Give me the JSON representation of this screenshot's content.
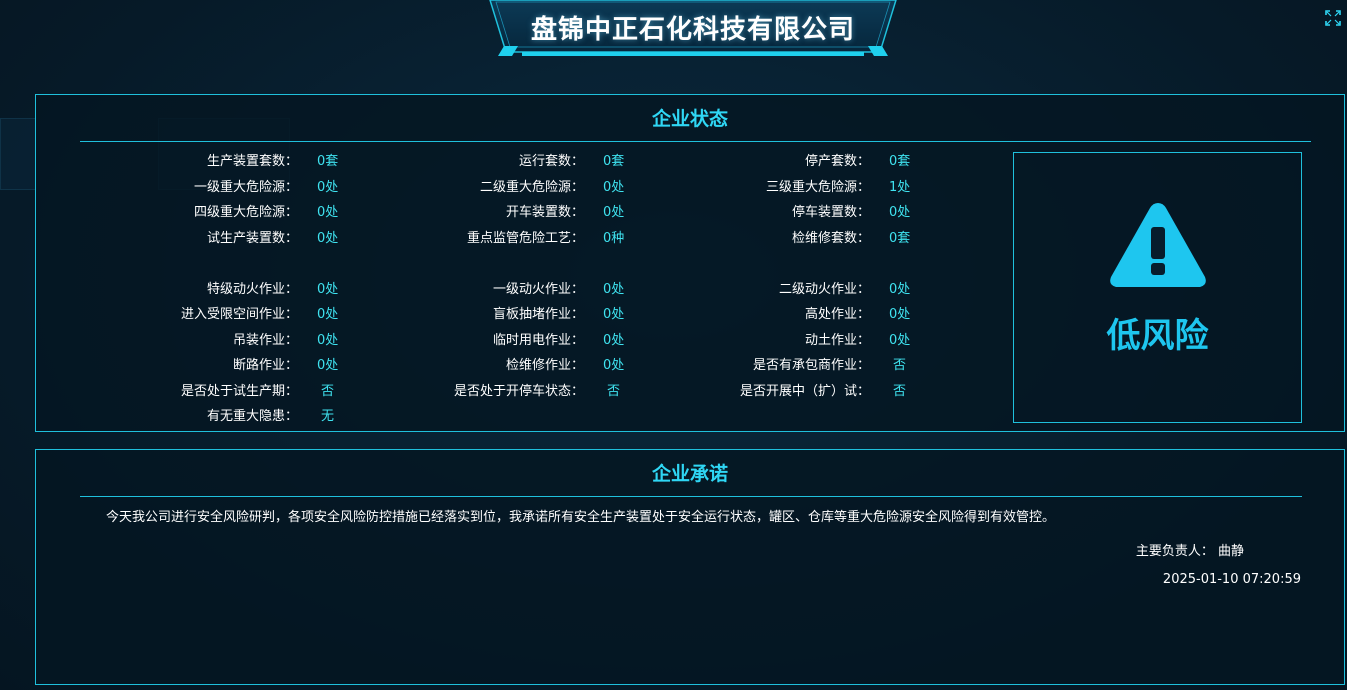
{
  "header": {
    "title": "盘锦中正石化科技有限公司"
  },
  "status_panel": {
    "title": "企业状态",
    "rows": [
      [
        {
          "label": "生产装置套数：",
          "value": "0套"
        },
        {
          "label": "运行套数：",
          "value": "0套"
        },
        {
          "label": "停产套数：",
          "value": "0套"
        }
      ],
      [
        {
          "label": "一级重大危险源：",
          "value": "0处"
        },
        {
          "label": "二级重大危险源：",
          "value": "0处"
        },
        {
          "label": "三级重大危险源：",
          "value": "1处"
        }
      ],
      [
        {
          "label": "四级重大危险源：",
          "value": "0处"
        },
        {
          "label": "开车装置数：",
          "value": "0处"
        },
        {
          "label": "停车装置数：",
          "value": "0处"
        }
      ],
      [
        {
          "label": "试生产装置数：",
          "value": "0处"
        },
        {
          "label": "重点监管危险工艺：",
          "value": "0种"
        },
        {
          "label": "检维修套数：",
          "value": "0套"
        }
      ],
      [
        {
          "label": "特级动火作业：",
          "value": "0处"
        },
        {
          "label": "一级动火作业：",
          "value": "0处"
        },
        {
          "label": "二级动火作业：",
          "value": "0处"
        }
      ],
      [
        {
          "label": "进入受限空间作业：",
          "value": "0处"
        },
        {
          "label": "盲板抽堵作业：",
          "value": "0处"
        },
        {
          "label": "高处作业：",
          "value": "0处"
        }
      ],
      [
        {
          "label": "吊装作业：",
          "value": "0处"
        },
        {
          "label": "临时用电作业：",
          "value": "0处"
        },
        {
          "label": "动土作业：",
          "value": "0处"
        }
      ],
      [
        {
          "label": "断路作业：",
          "value": "0处"
        },
        {
          "label": "检维修作业：",
          "value": "0处"
        },
        {
          "label": "是否有承包商作业：",
          "value": "否"
        }
      ],
      [
        {
          "label": "是否处于试生产期：",
          "value": "否"
        },
        {
          "label": "是否处于开停车状态：",
          "value": "否"
        },
        {
          "label": "是否开展中（扩）试：",
          "value": "否"
        }
      ],
      [
        {
          "label": "有无重大隐患：",
          "value": "无"
        }
      ]
    ],
    "risk": {
      "icon": "warning-triangle-icon",
      "level": "低风险",
      "color": "#1ec6ef"
    }
  },
  "promise_panel": {
    "title": "企业承诺",
    "text": "今天我公司进行安全风险研判，各项安全风险防控措施已经落实到位，我承诺所有安全生产装置处于安全运行状态，罐区、仓库等重大危险源安全风险得到有效管控。",
    "owner": "主要负责人： 曲静",
    "timestamp": "2025-01-10 07:20:59"
  },
  "colors": {
    "accent": "#1fc0dc",
    "value": "#3fe3f0",
    "title": "#2fd7f5"
  }
}
